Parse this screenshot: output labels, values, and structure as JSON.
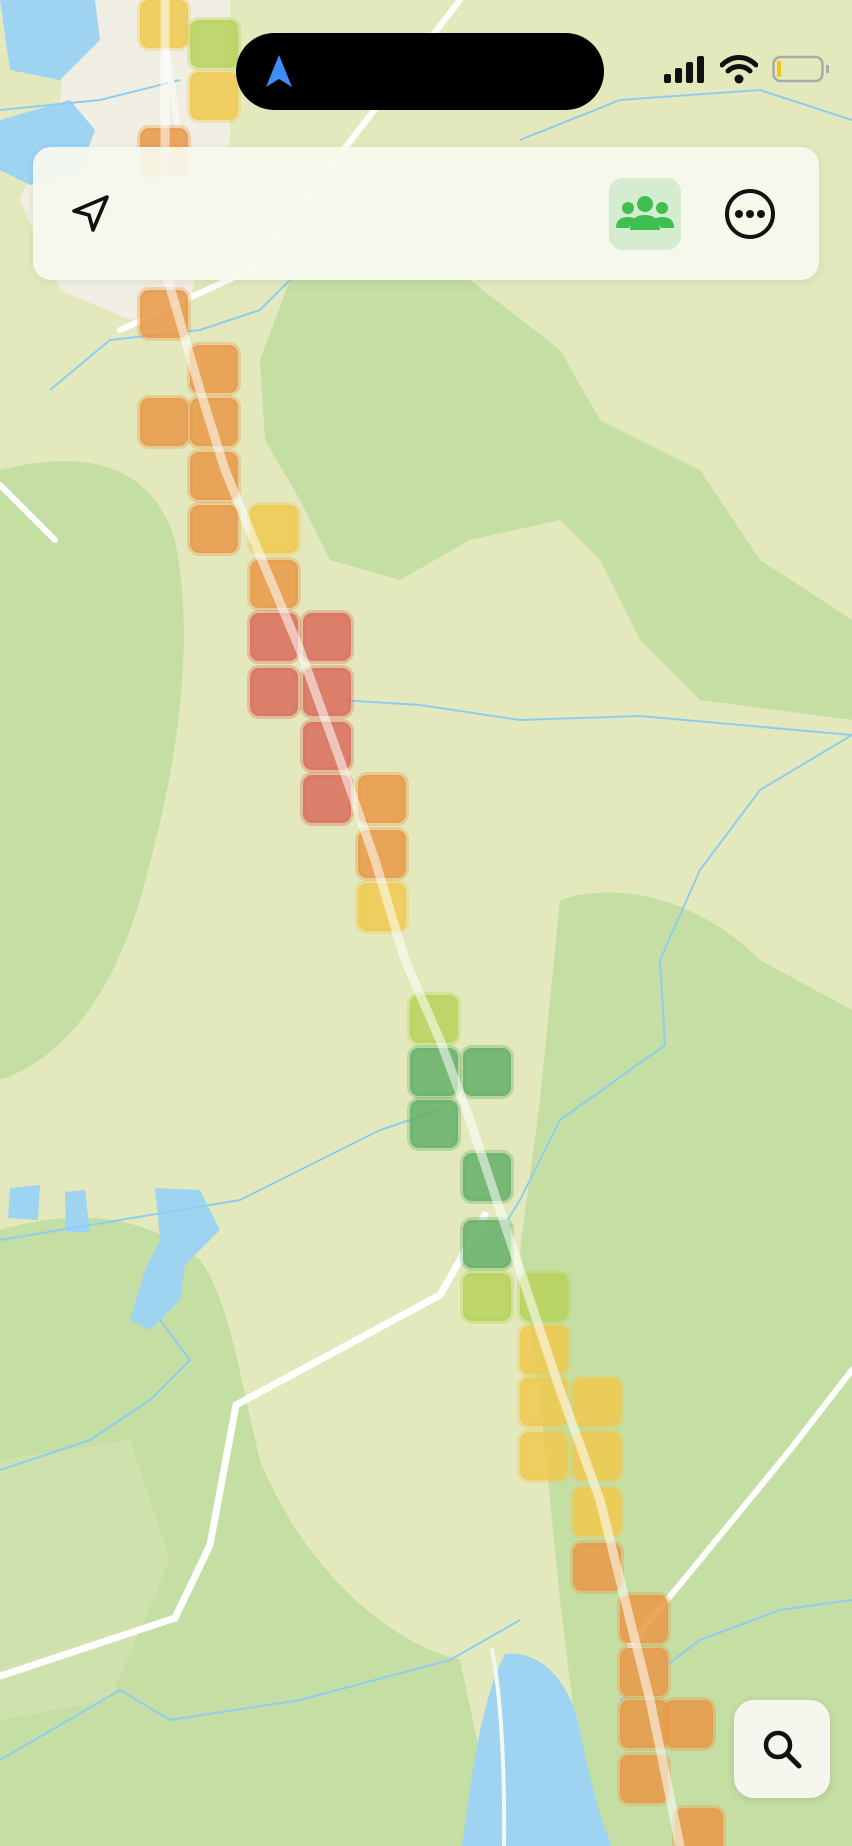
{
  "app": {
    "screen": "map-heat-trail"
  },
  "status_bar": {
    "cellular_bars": 4,
    "wifi": true,
    "battery_level": 0.1,
    "battery_color": "#f5c518"
  },
  "toolbar": {
    "locate_icon": "location-arrow-icon",
    "people_icon": "people-group-icon",
    "people_active": true,
    "more_icon": "ellipsis-circle-icon"
  },
  "search": {
    "icon": "magnifier-icon"
  },
  "colors": {
    "land_light": "#e3e9bd",
    "forest": "#c5dea4",
    "water": "#9fd3f2",
    "road": "#ffffff",
    "accent_green": "#3fbf4f",
    "heat_red": "#d9705f",
    "heat_orange": "#e89a4a",
    "heat_yellow": "#efc951",
    "heat_lime": "#b8d35d",
    "heat_green": "#66b06a"
  },
  "heat_levels": [
    "heat_yellow",
    "heat_lime",
    "heat_yellow",
    "heat_orange",
    "heat_orange",
    "heat_orange",
    "heat_orange",
    "heat_orange",
    "heat_orange",
    "heat_yellow",
    "heat_orange",
    "heat_orange",
    "heat_red",
    "heat_red",
    "heat_red",
    "heat_red",
    "heat_red",
    "heat_red",
    "heat_orange",
    "heat_orange",
    "heat_yellow",
    "heat_lime",
    "heat_green",
    "heat_green",
    "heat_green",
    "heat_green",
    "heat_green",
    "heat_lime",
    "heat_lime",
    "heat_yellow",
    "heat_yellow",
    "heat_yellow",
    "heat_yellow",
    "heat_yellow",
    "heat_yellow",
    "heat_orange",
    "heat_orange",
    "heat_orange",
    "heat_orange",
    "heat_orange",
    "heat_orange",
    "heat_orange"
  ]
}
